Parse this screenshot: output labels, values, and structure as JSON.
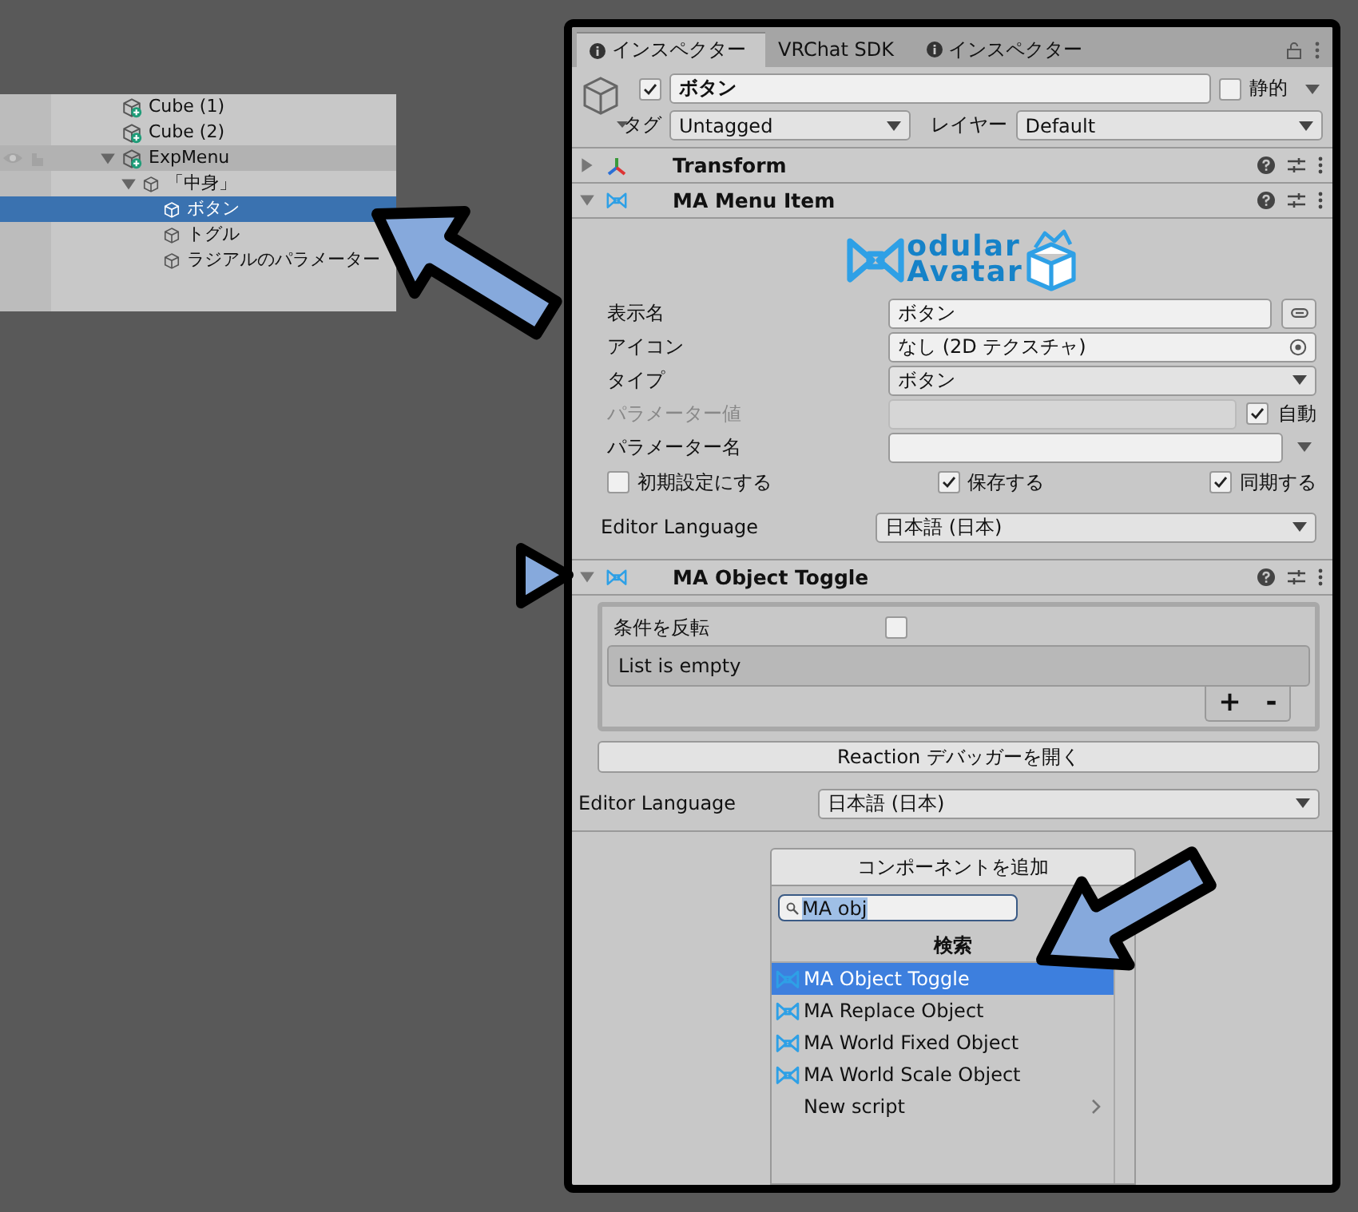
{
  "hierarchy": {
    "items": [
      {
        "label": "Cube (1)",
        "kind": "prefab",
        "selected": false,
        "hovered": false
      },
      {
        "label": "Cube (2)",
        "kind": "prefab",
        "selected": false,
        "hovered": false
      },
      {
        "label": "ExpMenu",
        "kind": "prefab",
        "selected": false,
        "hovered": true,
        "expanded": true,
        "children": [
          {
            "label": "「中身」",
            "kind": "object",
            "selected": false,
            "hovered": false,
            "expanded": true,
            "children": [
              {
                "label": "ボタン",
                "kind": "object",
                "selected": true,
                "hovered": false
              },
              {
                "label": "トグル",
                "kind": "object",
                "selected": false,
                "hovered": false
              },
              {
                "label": "ラジアルのパラメーター",
                "kind": "object",
                "selected": false,
                "hovered": false
              }
            ]
          }
        ]
      }
    ]
  },
  "inspector": {
    "tabs": [
      {
        "label": "インスペクター",
        "kind": "info",
        "selected": true
      },
      {
        "label": "VRChat SDK",
        "kind": "plain",
        "selected": false
      },
      {
        "label": "インスペクター",
        "kind": "info",
        "selected": false
      }
    ],
    "object": {
      "active": true,
      "name": "ボタン",
      "static": false,
      "static_label": "静的",
      "tag_label": "タグ",
      "tag": "Untagged",
      "layer_label": "レイヤー",
      "layer": "Default"
    },
    "components": [
      {
        "kind": "transform",
        "title": "Transform",
        "expanded": false
      },
      {
        "kind": "menu_item",
        "title": "MA Menu Item",
        "expanded": true,
        "logo": [
          "odular",
          "Avatar"
        ],
        "fields": [
          {
            "kind": "text",
            "label": "表示名",
            "value": "ボタン",
            "disabled": false
          },
          {
            "kind": "object",
            "label": "アイコン",
            "value": "なし (2D テクスチャ)",
            "disabled": false
          },
          {
            "kind": "dropdown",
            "label": "タイプ",
            "value": "ボタン",
            "disabled": false
          },
          {
            "kind": "auto",
            "label": "パラメーター値",
            "disabled": true,
            "checked": true,
            "check_label": "自動"
          },
          {
            "kind": "combo",
            "label": "パラメーター名",
            "disabled": false
          }
        ],
        "toggles": [
          {
            "label": "初期設定にする",
            "checked": false
          },
          {
            "label": "保存する",
            "checked": true
          },
          {
            "label": "同期する",
            "checked": true
          }
        ],
        "language_label": "Editor Language",
        "language": "日本語 (日本)"
      },
      {
        "kind": "object_toggle",
        "title": "MA Object Toggle",
        "expanded": true,
        "invert_label": "条件を反転",
        "invert": false,
        "list_empty": "List is empty",
        "add": "+",
        "remove": "-",
        "debugger_button": "Reaction デバッガーを開く",
        "language_label": "Editor Language",
        "language": "日本語 (日本)"
      }
    ],
    "add_component": {
      "button": "コンポーネントを追加",
      "search": "MA obj",
      "header": "検索",
      "results": [
        {
          "label": "MA Object Toggle",
          "kind": "component",
          "selected": true
        },
        {
          "label": "MA Replace Object",
          "kind": "component",
          "selected": false
        },
        {
          "label": "MA World Fixed Object",
          "kind": "component",
          "selected": false
        },
        {
          "label": "MA World Scale Object",
          "kind": "component",
          "selected": false
        },
        {
          "label": "New script",
          "kind": "submenu",
          "selected": false
        }
      ]
    }
  }
}
